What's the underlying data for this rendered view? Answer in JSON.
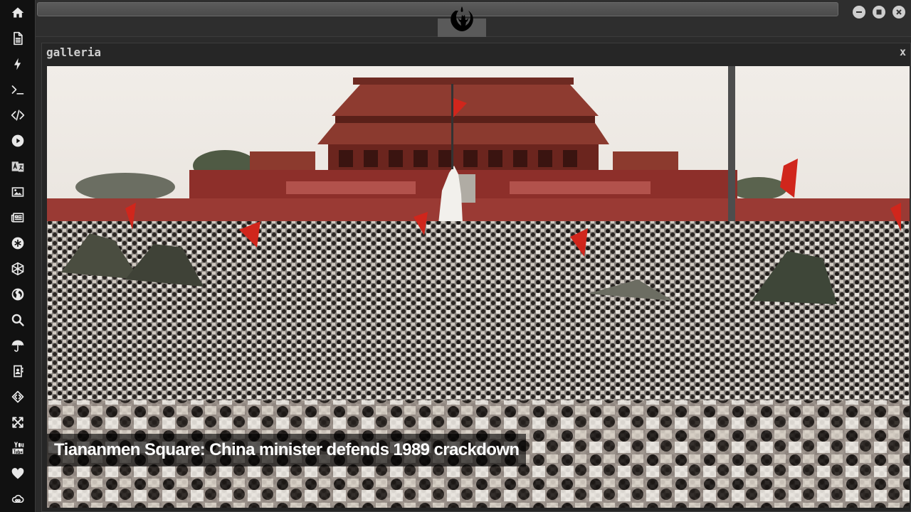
{
  "sidebar": {
    "items": [
      {
        "icon": "home-icon"
      },
      {
        "icon": "document-icon"
      },
      {
        "icon": "lightning-icon"
      },
      {
        "icon": "terminal-icon"
      },
      {
        "icon": "code-icon"
      },
      {
        "icon": "play-icon"
      },
      {
        "icon": "translate-icon"
      },
      {
        "icon": "image-icon"
      },
      {
        "icon": "newspaper-icon"
      },
      {
        "icon": "asterisk-icon"
      },
      {
        "icon": "hexagon-icon"
      },
      {
        "icon": "globe-icon"
      },
      {
        "icon": "search-icon"
      },
      {
        "icon": "umbrella-icon"
      },
      {
        "icon": "contact-book-icon"
      },
      {
        "icon": "code-diamond-icon"
      },
      {
        "icon": "expand-icon"
      },
      {
        "icon": "youtube-icon"
      },
      {
        "icon": "heart-icon"
      },
      {
        "icon": "infinity-cloud-icon"
      }
    ]
  },
  "topbar": {
    "address_value": "",
    "logo_icon": "rebel-alliance-logo-icon",
    "window_buttons": [
      "minimize-icon",
      "maximize-icon",
      "close-icon"
    ]
  },
  "gallery": {
    "title": "galleria",
    "close_label": "x",
    "image": {
      "caption": "Tiananmen Square: China minister defends 1989 crackdown"
    }
  },
  "colors": {
    "sidebar_bg": "#111111",
    "chrome_bg": "#2e2e2e",
    "caption_bg": "rgba(0,0,0,0.62)"
  }
}
